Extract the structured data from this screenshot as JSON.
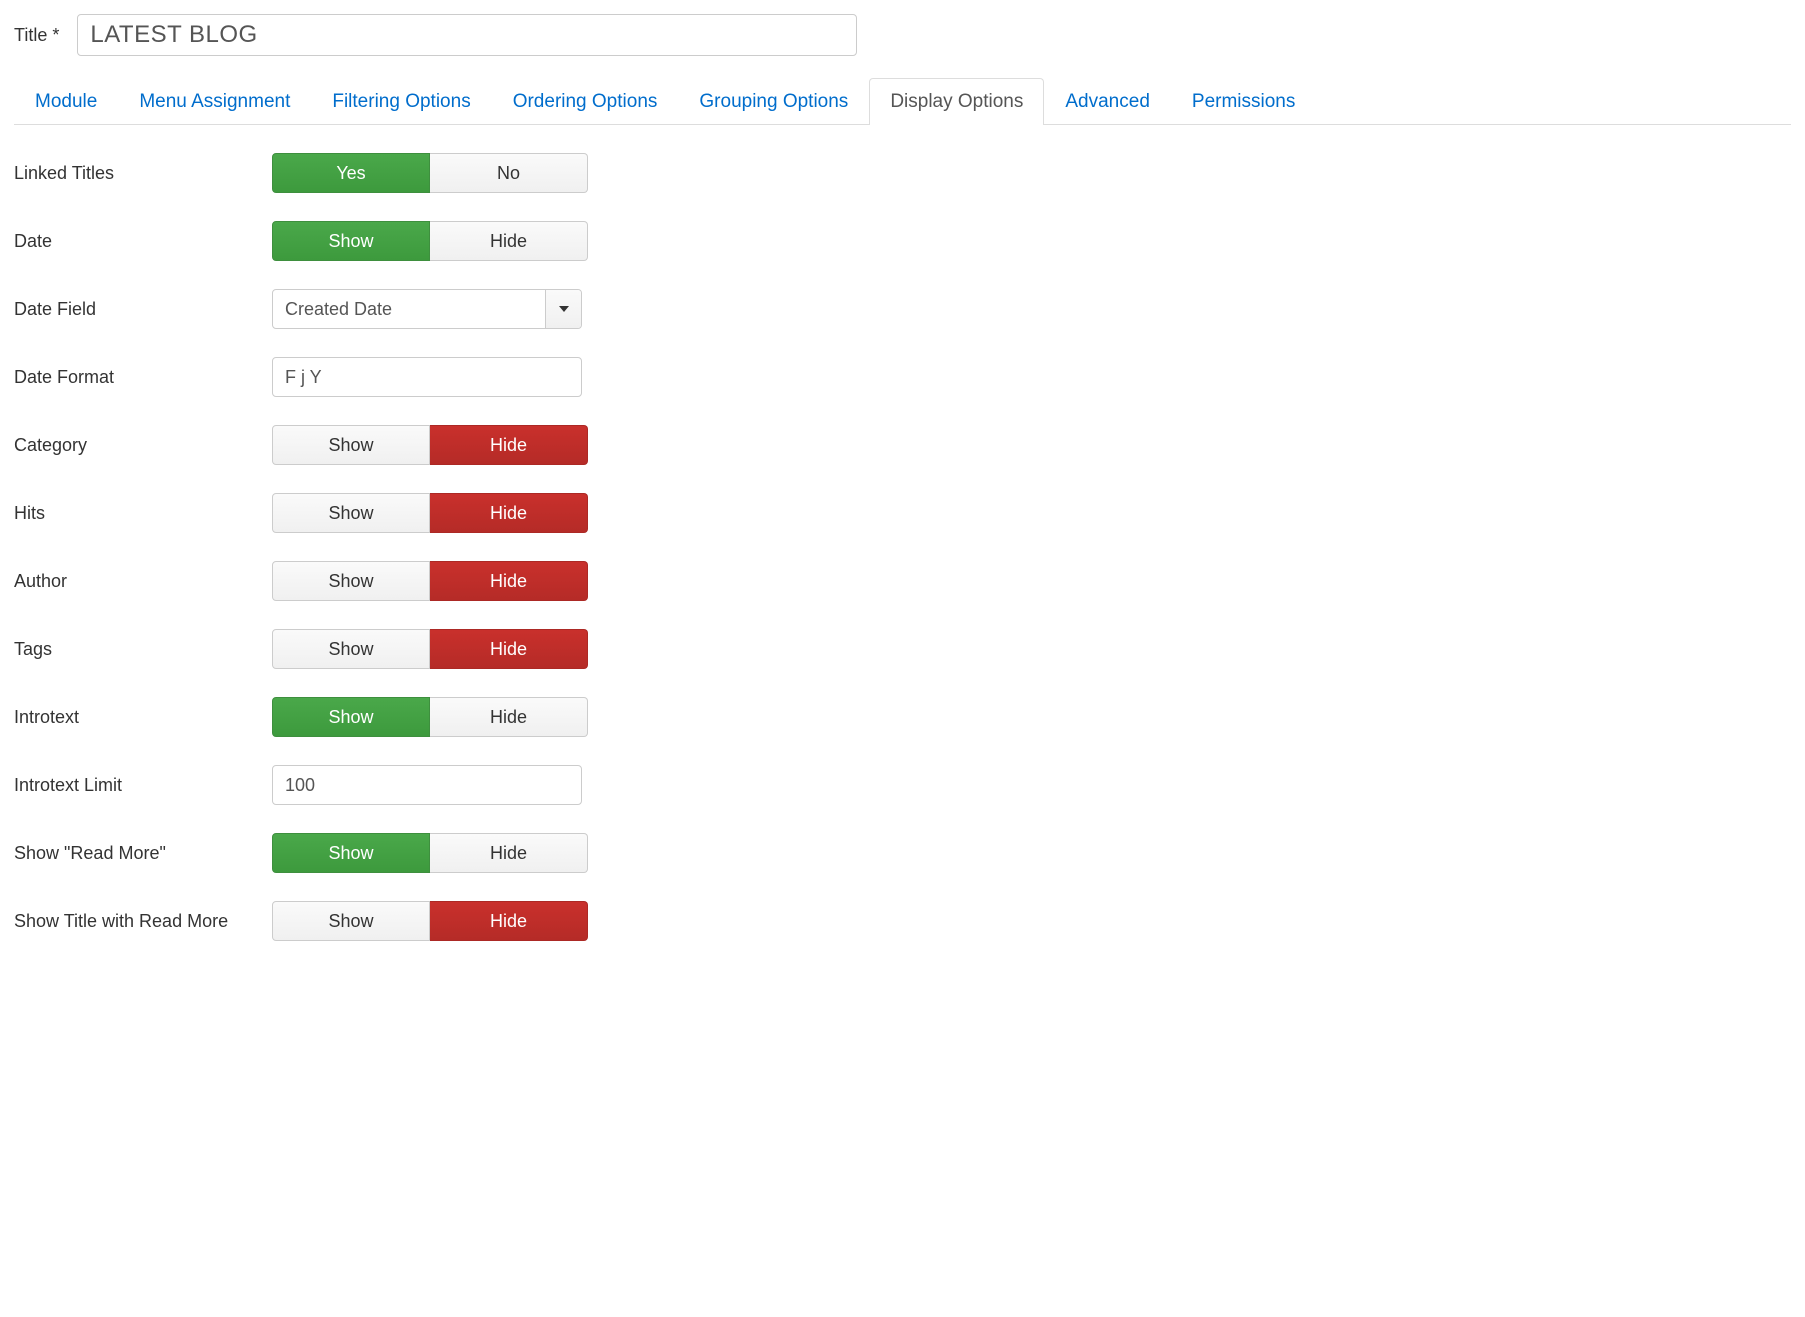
{
  "title_label": "Title *",
  "title_value": "LATEST BLOG",
  "tabs": [
    {
      "label": "Module"
    },
    {
      "label": "Menu Assignment"
    },
    {
      "label": "Filtering Options"
    },
    {
      "label": "Ordering Options"
    },
    {
      "label": "Grouping Options"
    },
    {
      "label": "Display Options"
    },
    {
      "label": "Advanced"
    },
    {
      "label": "Permissions"
    }
  ],
  "labels": {
    "linked_titles": "Linked Titles",
    "date": "Date",
    "date_field": "Date Field",
    "date_format": "Date Format",
    "category": "Category",
    "hits": "Hits",
    "author": "Author",
    "tags": "Tags",
    "introtext": "Introtext",
    "introtext_limit": "Introtext Limit",
    "read_more": "Show \"Read More\"",
    "title_read_more": "Show Title with Read More"
  },
  "opts": {
    "yes": "Yes",
    "no": "No",
    "show": "Show",
    "hide": "Hide"
  },
  "date_field_value": "Created Date",
  "date_format_value": "F j Y",
  "introtext_limit_value": "100"
}
